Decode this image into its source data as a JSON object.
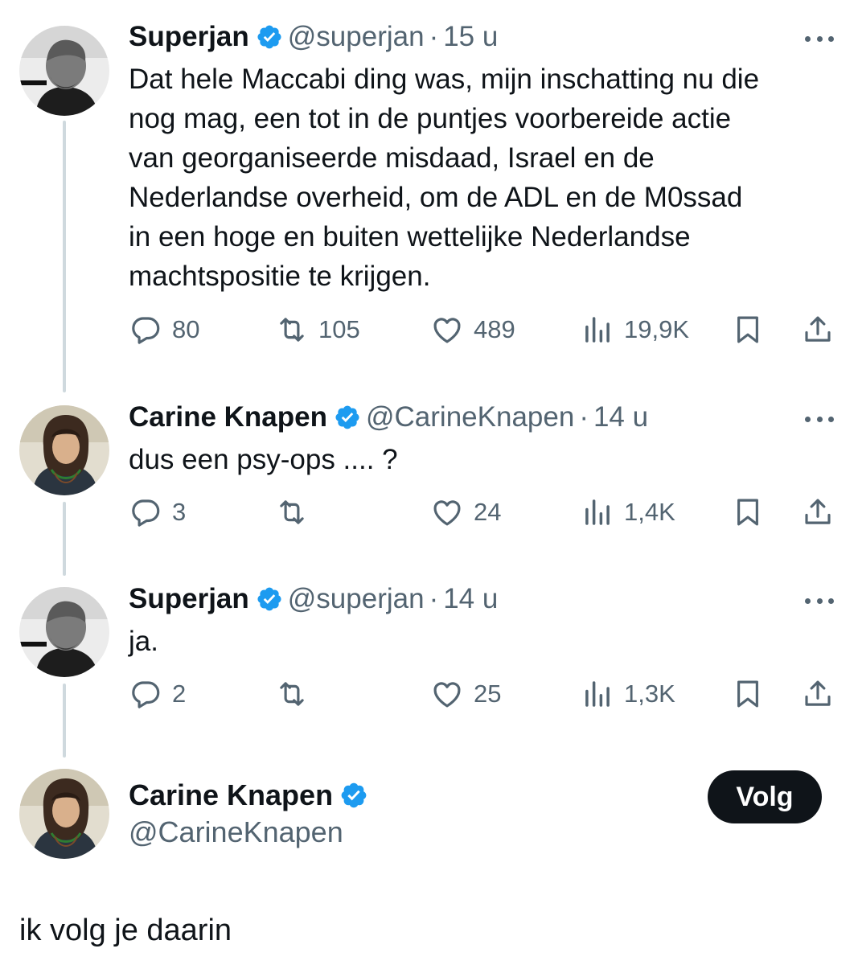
{
  "colors": {
    "text": "#0f1419",
    "secondary": "#536471",
    "verified": "#1d9bf0",
    "thread_line": "#cfd9de",
    "follow_bg": "#0f1419"
  },
  "tweets": [
    {
      "name": "Superjan",
      "handle": "@superjan",
      "separator": "·",
      "time": "15 u",
      "text_lines": [
        "Dat hele Maccabi ding was, mijn inschatting nu die",
        "nog mag, een tot in de puntjes voorbereide actie",
        "van georganiseerde misdaad, Israel en de",
        "Nederlandse overheid, om de ADL en de M0ssad",
        "in een hoge en buiten wettelijke Nederlandse",
        "machtspositie te krijgen."
      ],
      "replies": "80",
      "retweets": "105",
      "likes": "489",
      "views": "19,9K"
    },
    {
      "name": "Carine Knapen",
      "handle": "@CarineKnapen",
      "separator": "·",
      "time": "14 u",
      "text_lines": [
        "dus een psy-ops .... ?"
      ],
      "replies": "3",
      "retweets": "",
      "likes": "24",
      "views": "1,4K"
    },
    {
      "name": "Superjan",
      "handle": "@superjan",
      "separator": "·",
      "time": "14 u",
      "text_lines": [
        "ja."
      ],
      "replies": "2",
      "retweets": "",
      "likes": "25",
      "views": "1,3K"
    }
  ],
  "focused": {
    "name": "Carine Knapen",
    "handle": "@CarineKnapen",
    "follow_label": "Volg",
    "text": "ik volg je daarin"
  },
  "icons": [
    "reply-icon",
    "retweet-icon",
    "like-icon",
    "views-icon",
    "bookmark-icon",
    "share-icon",
    "more-icon",
    "verified-badge-icon"
  ]
}
